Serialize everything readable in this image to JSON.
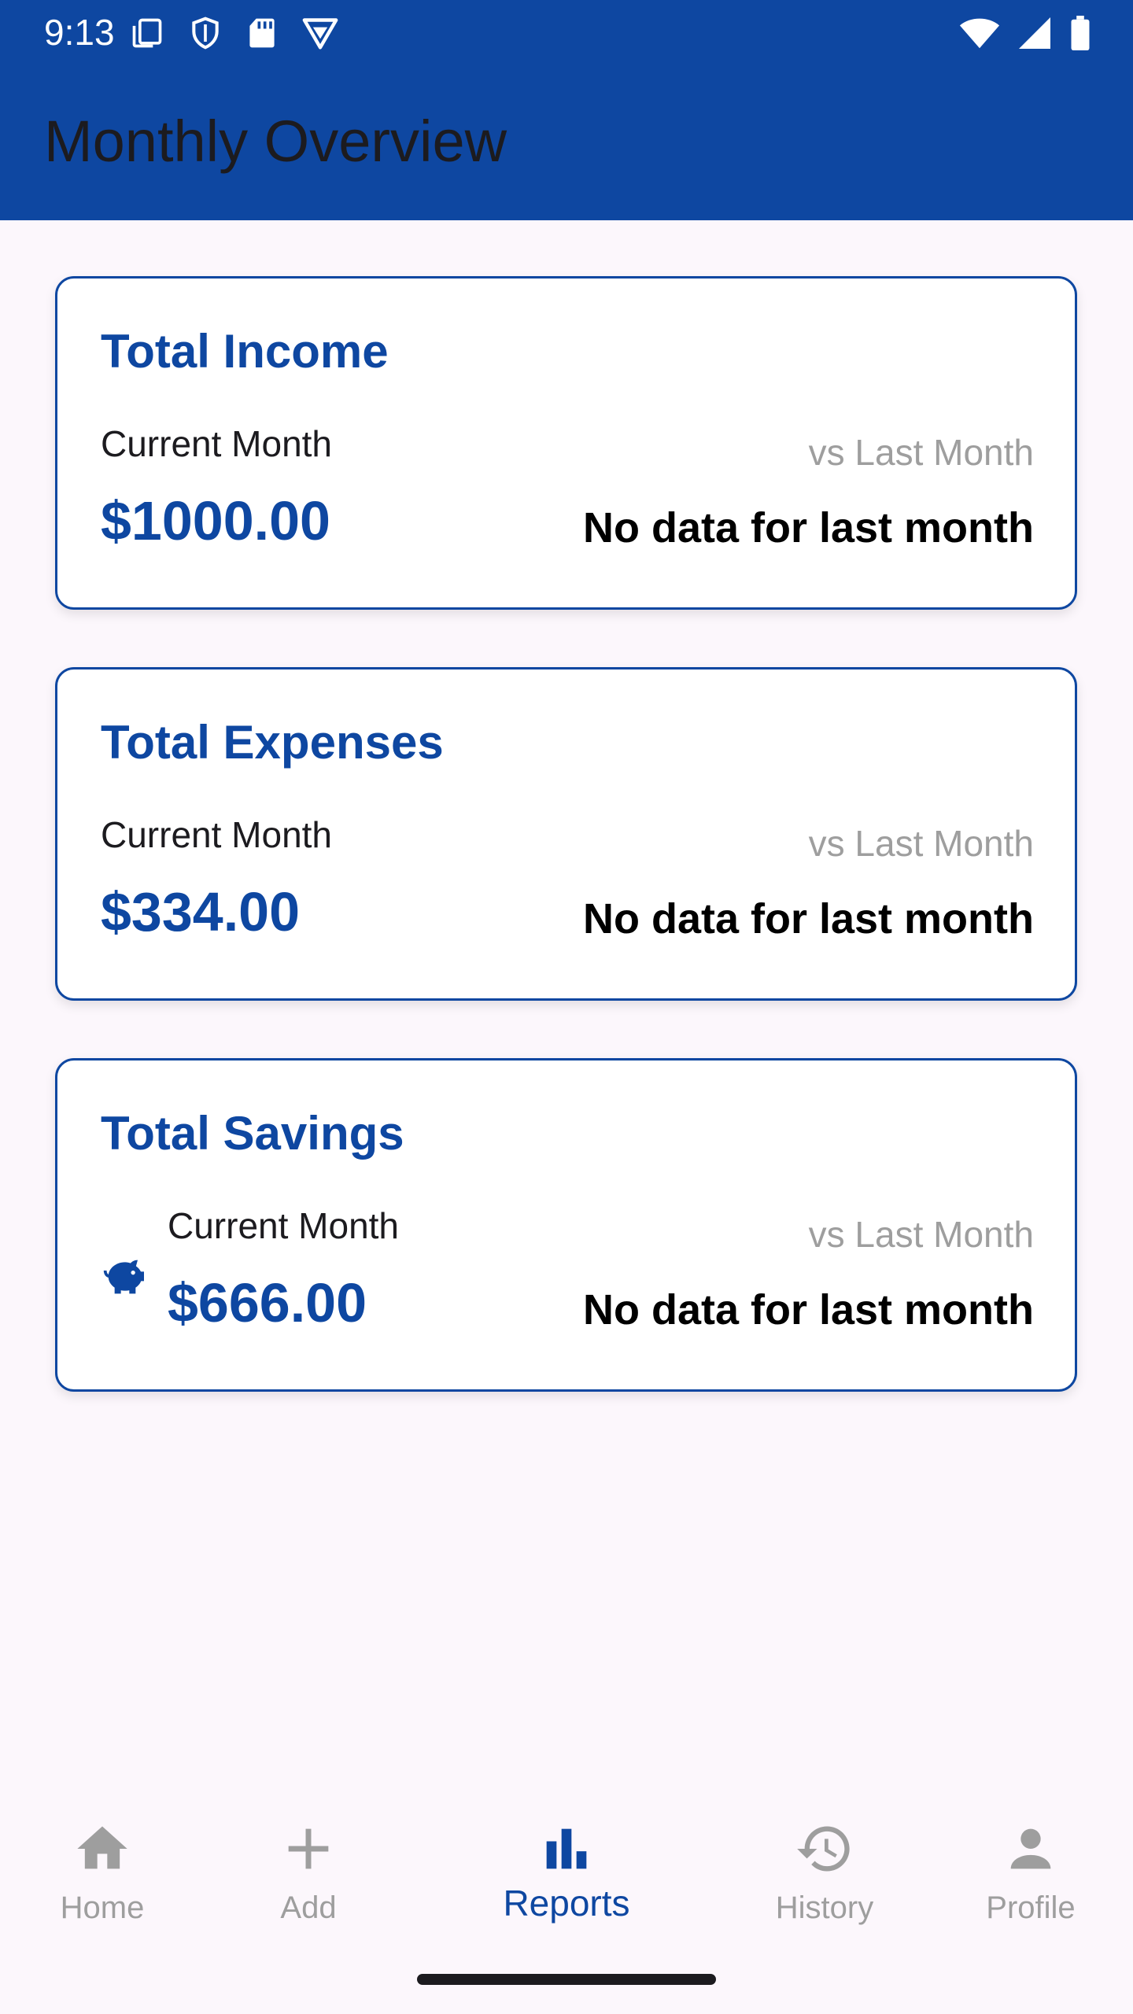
{
  "status_bar": {
    "time": "9:13"
  },
  "app_bar": {
    "title": "Monthly Overview"
  },
  "cards": [
    {
      "title": "Total Income",
      "current_label": "Current Month",
      "current_value": "$1000.00",
      "compare_label": "vs Last Month",
      "compare_value": "No data for last month"
    },
    {
      "title": "Total Expenses",
      "current_label": "Current Month",
      "current_value": "$334.00",
      "compare_label": "vs Last Month",
      "compare_value": "No data for last month"
    },
    {
      "title": "Total Savings",
      "icon": "piggy-bank-icon",
      "current_label": "Current Month",
      "current_value": "$666.00",
      "compare_label": "vs Last Month",
      "compare_value": "No data for last month"
    }
  ],
  "bottom_nav": {
    "items": [
      {
        "label": "Home",
        "icon": "home-icon",
        "active": false
      },
      {
        "label": "Add",
        "icon": "plus-icon",
        "active": false
      },
      {
        "label": "Reports",
        "icon": "bar-chart-icon",
        "active": true
      },
      {
        "label": "History",
        "icon": "history-icon",
        "active": false
      },
      {
        "label": "Profile",
        "icon": "person-icon",
        "active": false
      }
    ]
  },
  "colors": {
    "primary": "#0e47a1",
    "background": "#fcf7fc",
    "muted": "#9e9e9e",
    "text": "#1c1b1f"
  }
}
